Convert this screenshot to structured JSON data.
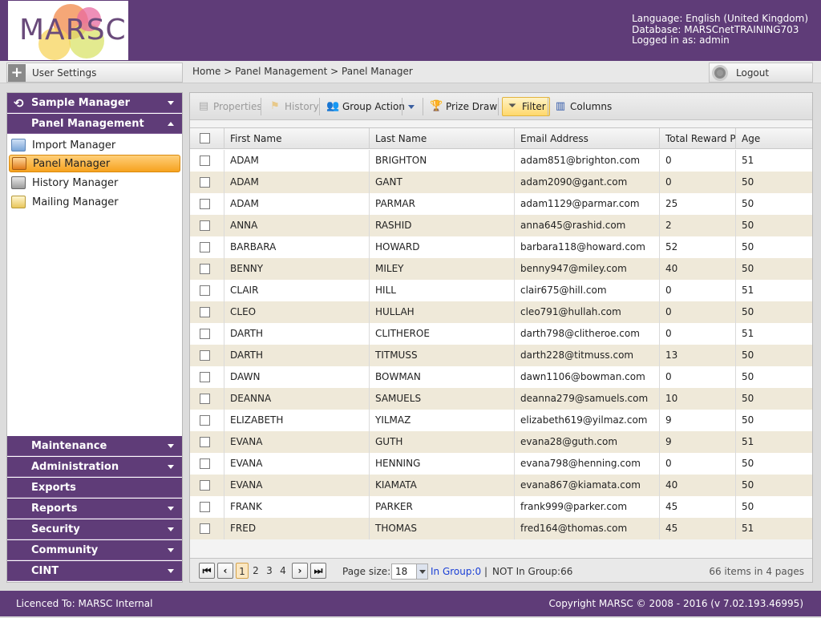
{
  "header": {
    "logo_text": "MARSC",
    "language_line": "Language: English (United Kingdom)",
    "database_line": "Database: MARSCnetTRAINING703",
    "user_line": "Logged in as: admin"
  },
  "toprow": {
    "user_settings_label": "User Settings",
    "breadcrumb": "Home > Panel Management > Panel Manager",
    "logout_label": "Logout"
  },
  "sidebar": {
    "sample_manager": "Sample Manager",
    "panel_management": "Panel Management",
    "items": [
      {
        "label": "Import Manager",
        "icon": "import-icon"
      },
      {
        "label": "Panel Manager",
        "icon": "panel-icon"
      },
      {
        "label": "History Manager",
        "icon": "history-icon"
      },
      {
        "label": "Mailing Manager",
        "icon": "mailing-icon"
      }
    ],
    "sections": [
      "Maintenance",
      "Administration",
      "Exports",
      "Reports",
      "Security",
      "Community",
      "CINT"
    ]
  },
  "toolbar": {
    "properties": "Properties",
    "history": "History",
    "group_action": "Group Action",
    "prize_draw": "Prize Draw",
    "filter": "Filter",
    "columns": "Columns"
  },
  "grid": {
    "columns": [
      "First Name",
      "Last Name",
      "Email Address",
      "Total Reward Po",
      "Age"
    ],
    "rows": [
      [
        "ADAM",
        "BRIGHTON",
        "adam851@brighton.com",
        "0",
        "51"
      ],
      [
        "ADAM",
        "GANT",
        "adam2090@gant.com",
        "0",
        "50"
      ],
      [
        "ADAM",
        "PARMAR",
        "adam1129@parmar.com",
        "25",
        "50"
      ],
      [
        "ANNA",
        "RASHID",
        "anna645@rashid.com",
        "2",
        "50"
      ],
      [
        "BARBARA",
        "HOWARD",
        "barbara118@howard.com",
        "52",
        "50"
      ],
      [
        "BENNY",
        "MILEY",
        "benny947@miley.com",
        "40",
        "50"
      ],
      [
        "CLAIR",
        "HILL",
        "clair675@hill.com",
        "0",
        "51"
      ],
      [
        "CLEO",
        "HULLAH",
        "cleo791@hullah.com",
        "0",
        "50"
      ],
      [
        "DARTH",
        "CLITHEROE",
        "darth798@clitheroe.com",
        "0",
        "51"
      ],
      [
        "DARTH",
        "TITMUSS",
        "darth228@titmuss.com",
        "13",
        "50"
      ],
      [
        "DAWN",
        "BOWMAN",
        "dawn1106@bowman.com",
        "0",
        "50"
      ],
      [
        "DEANNA",
        "SAMUELS",
        "deanna279@samuels.com",
        "10",
        "50"
      ],
      [
        "ELIZABETH",
        "YILMAZ",
        "elizabeth619@yilmaz.com",
        "9",
        "50"
      ],
      [
        "EVANA",
        "GUTH",
        "evana28@guth.com",
        "9",
        "51"
      ],
      [
        "EVANA",
        "HENNING",
        "evana798@henning.com",
        "0",
        "50"
      ],
      [
        "EVANA",
        "KIAMATA",
        "evana867@kiamata.com",
        "40",
        "50"
      ],
      [
        "FRANK",
        "PARKER",
        "frank999@parker.com",
        "45",
        "50"
      ],
      [
        "FRED",
        "THOMAS",
        "fred164@thomas.com",
        "45",
        "51"
      ]
    ]
  },
  "pager": {
    "pages": [
      "1",
      "2",
      "3",
      "4"
    ],
    "page_size_label": "Page size:",
    "page_size_value": "18",
    "in_group": "In Group:0",
    "separator": "|",
    "not_in_group": "NOT In Group:66",
    "summary": "66 items in 4 pages"
  },
  "footer": {
    "licence": "Licenced To: MARSC Internal",
    "copyright": "Copyright MARSC © 2008 - 2016  (v 7.02.193.46995)"
  },
  "colors": {
    "brand_purple": "#5f3c78",
    "row_alt": "#efe9d9",
    "active_orange": "#f6a21f",
    "link_blue": "#1a3fd6"
  }
}
